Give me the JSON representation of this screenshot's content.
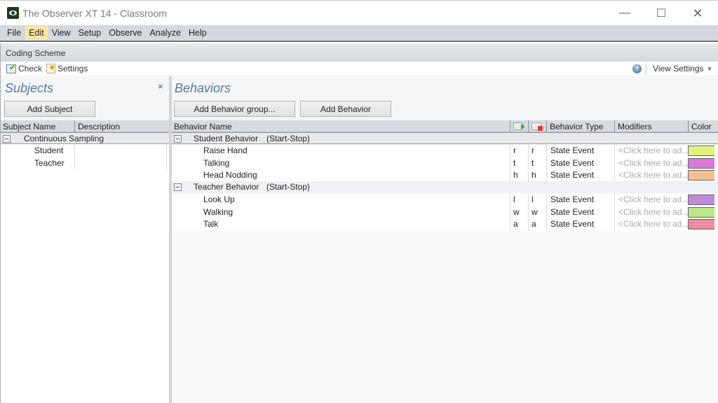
{
  "window": {
    "title": "The Observer XT 14 - Classroom",
    "controls": {
      "minimize": "—",
      "maximize": "☐",
      "close": "✕"
    }
  },
  "menu": {
    "items": [
      {
        "label": "File",
        "active": false
      },
      {
        "label": "Edit",
        "active": true
      },
      {
        "label": "View",
        "active": false
      },
      {
        "label": "Setup",
        "active": false
      },
      {
        "label": "Observe",
        "active": false
      },
      {
        "label": "Analyze",
        "active": false
      },
      {
        "label": "Help",
        "active": false
      }
    ]
  },
  "coding_scheme": {
    "header": "Coding Scheme",
    "toolbar": {
      "check_label": "Check",
      "settings_label": "Settings",
      "help_icon": "?",
      "view_settings_label": "View Settings",
      "view_settings_caret": "▼"
    }
  },
  "subjects": {
    "title": "Subjects",
    "close_icon": "×",
    "add_button": "Add Subject",
    "columns": [
      "Subject Name",
      "Description"
    ],
    "group": {
      "name": "Continuous Sampling"
    },
    "items": [
      {
        "name": "Student",
        "description": ""
      },
      {
        "name": "Teacher",
        "description": ""
      }
    ]
  },
  "behaviors": {
    "title": "Behaviors",
    "add_group_button": "Add Behavior group...",
    "add_behavior_button": "Add Behavior",
    "columns": {
      "name": "Behavior Name",
      "start_key_icon": "start-key-icon",
      "stop_key_icon": "stop-key-icon",
      "type": "Behavior Type",
      "modifiers": "Modifiers",
      "color": "Color"
    },
    "groups": [
      {
        "name": "Student Behavior",
        "mode": "(Start-Stop)",
        "items": [
          {
            "name": "Raise Hand",
            "start_key": "r",
            "stop_key": "r",
            "type": "State Event",
            "modifiers": "<Click here to ad...",
            "color": "#e4f27e"
          },
          {
            "name": "Talking",
            "start_key": "t",
            "stop_key": "t",
            "type": "State Event",
            "modifiers": "<Click here to ad...",
            "color": "#dc78d8"
          },
          {
            "name": "Head Nodding",
            "start_key": "h",
            "stop_key": "h",
            "type": "State Event",
            "modifiers": "<Click here to ad...",
            "color": "#f7be92"
          }
        ]
      },
      {
        "name": "Teacher Behavior",
        "mode": "(Start-Stop)",
        "items": [
          {
            "name": "Look Up",
            "start_key": "l",
            "stop_key": "l",
            "type": "State Event",
            "modifiers": "<Click here to ad...",
            "color": "#c08ad8"
          },
          {
            "name": "Walking",
            "start_key": "w",
            "stop_key": "w",
            "type": "State Event",
            "modifiers": "<Click here to ad...",
            "color": "#bce88a"
          },
          {
            "name": "Talk",
            "start_key": "a",
            "stop_key": "a",
            "type": "State Event",
            "modifiers": "<Click here to ad...",
            "color": "#ec8c9c"
          }
        ]
      }
    ]
  }
}
